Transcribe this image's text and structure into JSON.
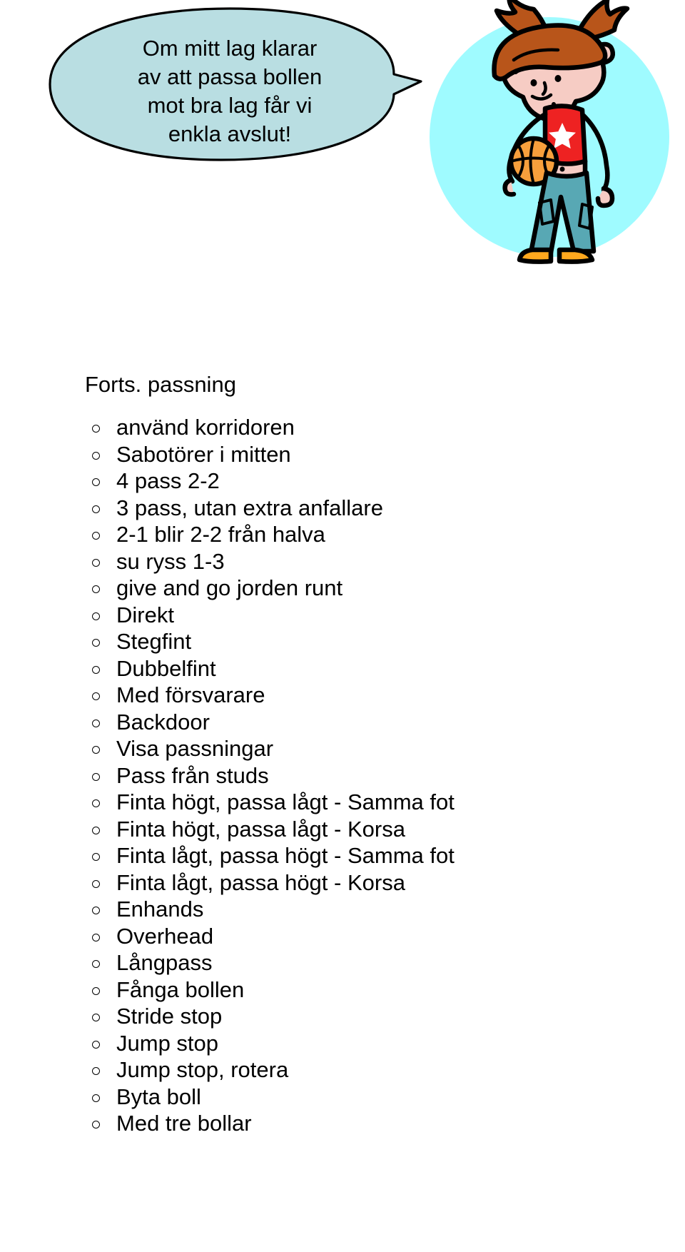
{
  "speech_bubble": {
    "text": "Om mitt lag klarar\nav att passa bollen\nmot bra lag får vi\nenkla avslut!",
    "fill_color": "#b9dee2",
    "stroke_color": "#000000"
  },
  "illustration": {
    "name": "girl-with-basketball",
    "background_circle_color": "#9ffbff",
    "skin_color": "#f6ccc4",
    "hair_color": "#b8551a",
    "shirt_color": "#ee2222",
    "star_color": "#ffffff",
    "pants_color": "#58a8b4",
    "shoes_color": "#ffa81e",
    "ball_color": "#f79f3c",
    "outline_color": "#000000"
  },
  "content": {
    "heading": "Forts. passning",
    "bullet_marker": "o",
    "items": [
      "använd korridoren",
      "Sabotörer i mitten",
      "4 pass 2-2",
      "3 pass, utan extra anfallare",
      "2-1 blir 2-2 från halva",
      "su ryss 1-3",
      "give and go jorden runt",
      "Direkt",
      "Stegfint",
      "Dubbelfint",
      "Med försvarare",
      "Backdoor",
      "Visa passningar",
      "Pass från studs",
      "Finta högt, passa lågt - Samma fot",
      "Finta högt, passa lågt - Korsa",
      "Finta lågt, passa högt - Samma fot",
      "Finta lågt, passa högt - Korsa",
      "Enhands",
      "Overhead",
      "Långpass",
      "Fånga bollen",
      "Stride stop",
      "Jump stop",
      "Jump stop, rotera",
      "Byta boll",
      "Med tre bollar"
    ]
  }
}
